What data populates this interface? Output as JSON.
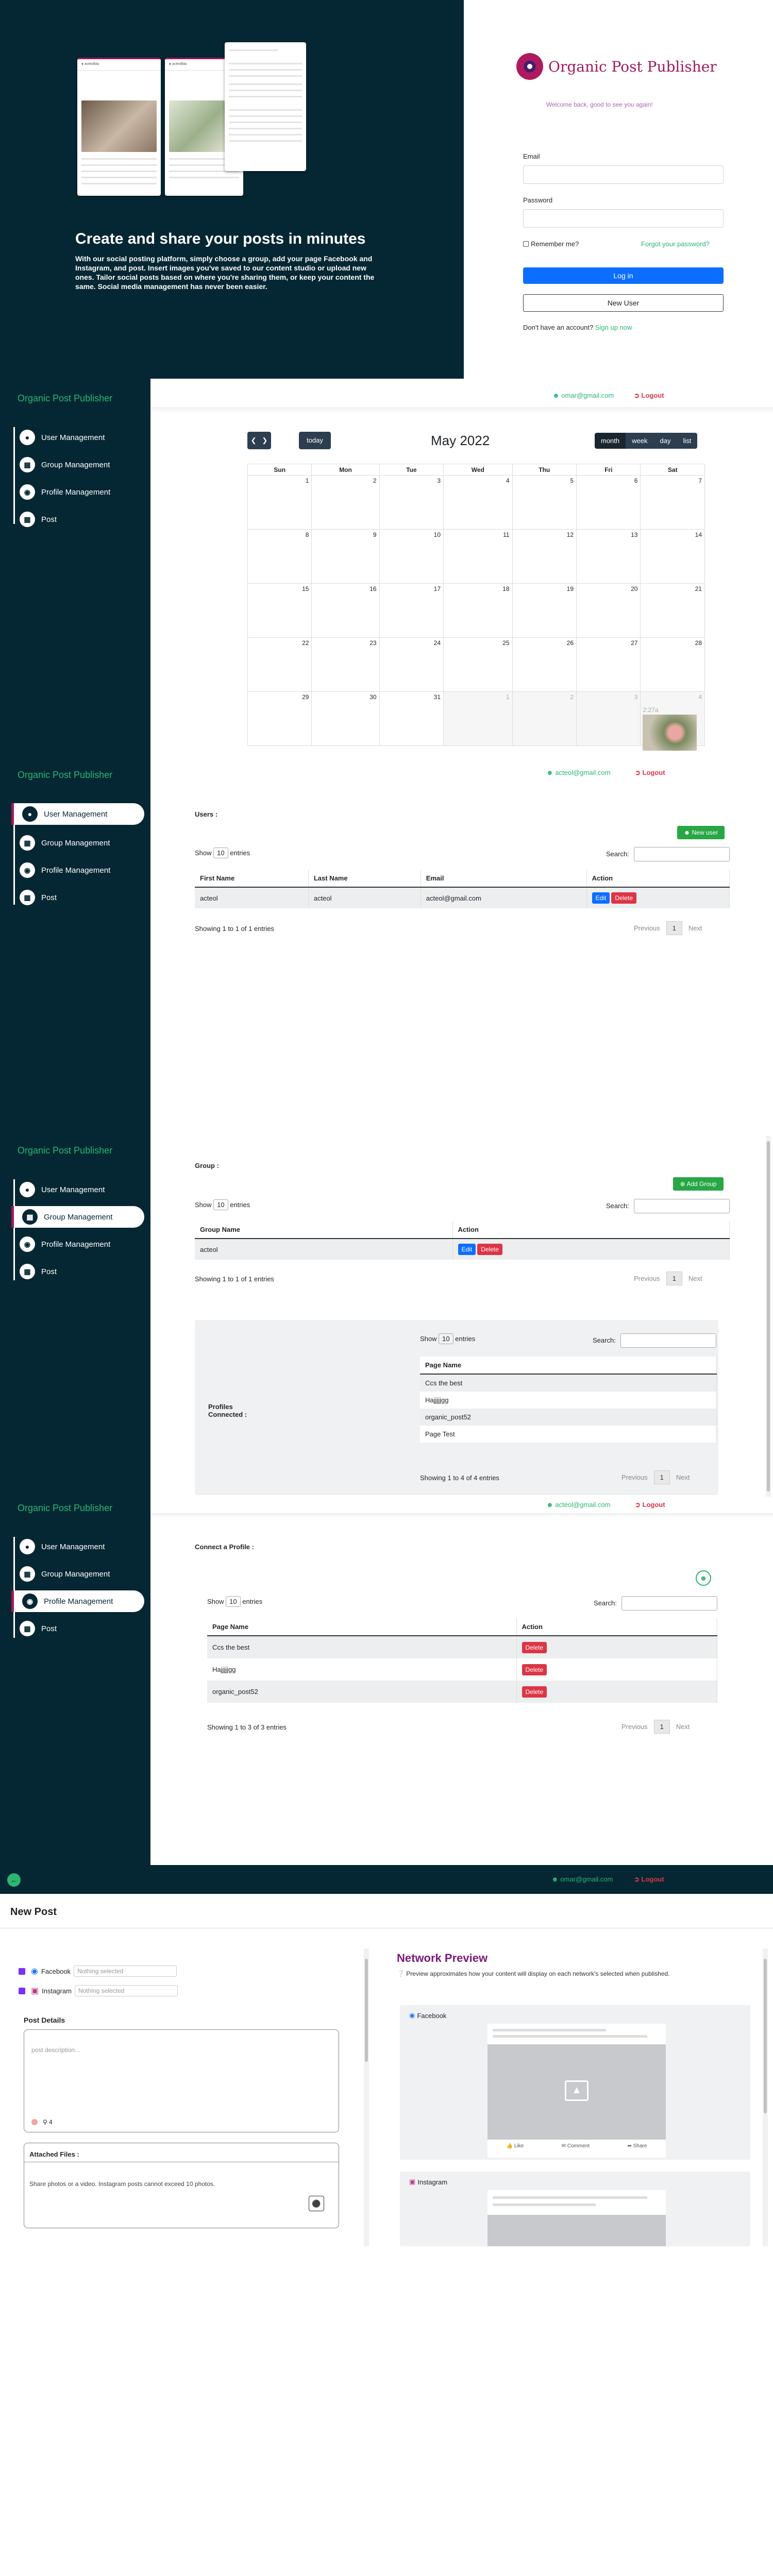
{
  "login": {
    "hero_title": "Create and share your posts in minutes",
    "hero_text": "With our social posting platform, simply choose a group, add your page Facebook and Instagram, and post. Insert images you've saved to our content studio or upload new ones. Tailor social posts based on where you're sharing them, or keep your content the same. Social media management has never been easier.",
    "brand": "Organic Post Publisher",
    "welcome": "Welcome back, good to see you again!",
    "email_label": "Email",
    "password_label": "Password",
    "remember": "Remember me?",
    "forgot": "Forgot your password?",
    "login_btn": "Log in",
    "new_user_btn": "New User",
    "no_account": "Don't have an account?",
    "sign_up": "Sign up now"
  },
  "app_title": "Organic Post Publisher",
  "nav": {
    "user_mgmt": "User Management",
    "group_mgmt": "Group Management",
    "profile_mgmt": "Profile Management",
    "post": "Post"
  },
  "calendar_view": {
    "user": "omar@gmail.com",
    "logout": "Logout",
    "today": "today",
    "title": "May 2022",
    "views": [
      "month",
      "week",
      "day",
      "list"
    ],
    "weekdays": [
      "Sun",
      "Mon",
      "Tue",
      "Wed",
      "Thu",
      "Fri",
      "Sat"
    ],
    "weeks": [
      [
        "1",
        "2",
        "3",
        "4",
        "5",
        "6",
        "7"
      ],
      [
        "8",
        "9",
        "10",
        "11",
        "12",
        "13",
        "14"
      ],
      [
        "15",
        "16",
        "17",
        "18",
        "19",
        "20",
        "21"
      ],
      [
        "22",
        "23",
        "24",
        "25",
        "26",
        "27",
        "28"
      ],
      [
        "29",
        "30",
        "31",
        "1",
        "2",
        "3",
        "4"
      ]
    ],
    "event_time": "2:27a"
  },
  "users_view": {
    "user": "acteol@gmail.com",
    "logout": "Logout",
    "label": "Users :",
    "new_btn": "New user",
    "show": "Show",
    "entries_value": "10",
    "entries": "entries",
    "search": "Search:",
    "columns": [
      "First Name",
      "Last Name",
      "Email",
      "Action"
    ],
    "rows": [
      [
        "acteol",
        "acteol",
        "acteol@gmail.com"
      ]
    ],
    "edit": "Edit",
    "delete": "Delete",
    "info": "Showing 1 to 1 of 1 entries",
    "prev": "Previous",
    "page": "1",
    "next": "Next"
  },
  "group_view": {
    "label": "Group :",
    "add_btn": "Add Group",
    "show": "Show",
    "entries_value": "10",
    "entries": "entries",
    "search": "Search:",
    "columns": [
      "Group Name",
      "Action"
    ],
    "rows": [
      [
        "acteol"
      ]
    ],
    "edit": "Edit",
    "delete": "Delete",
    "info": "Showing 1 to 1 of 1 entries",
    "prev": "Previous",
    "page": "1",
    "next": "Next",
    "profiles_label": "Profiles Connected :",
    "profile_column": "Page Name",
    "profiles": [
      "Ccs the best",
      "Hajjjjjgg",
      "organic_post52",
      "Page Test"
    ],
    "profiles_info": "Showing 1 to 4 of 4 entries"
  },
  "profile_view": {
    "user": "acteol@gmail.com",
    "logout": "Logout",
    "label": "Connect a Profile :",
    "show": "Show",
    "entries_value": "10",
    "entries": "entries",
    "search": "Search:",
    "columns": [
      "Page Name",
      "Action"
    ],
    "rows": [
      "Ccs the best",
      "Hajjjjjgg",
      "organic_post52"
    ],
    "delete": "Delete",
    "info": "Showing 1 to 3 of 3 entries",
    "prev": "Previous",
    "page": "1",
    "next": "Next"
  },
  "post_view": {
    "user": "omar@gmail.com",
    "logout": "Logout",
    "title": "New Post",
    "facebook": "Facebook",
    "instagram": "Instagram",
    "nothing": "Nothing selected",
    "post_details": "Post Details",
    "placeholder": "post description...",
    "location_count": "4",
    "attached": "Attached Files :",
    "attached_hint": "Share photos or a video. Instagram posts cannot exceed 10 photos.",
    "preview_title": "Network Preview",
    "preview_hint": "Preview approximates how your content will display on each network's selected when published.",
    "like": "Like",
    "comment": "Comment",
    "share": "Share"
  },
  "colors": {
    "sidebar": "#052733",
    "accent_green": "#2bb673",
    "brand": "#a0195c",
    "primary": "#0d6efd",
    "danger": "#dc3545"
  }
}
